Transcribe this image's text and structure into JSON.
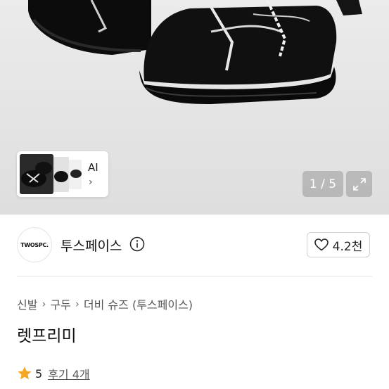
{
  "gallery": {
    "counter": "1 / 5",
    "ai_label": "AI",
    "chevron": "›",
    "expand_icon": "expand-icon"
  },
  "seller": {
    "logo_text": "TWOSPC.",
    "name": "투스페이스",
    "like_count": "4.2천"
  },
  "breadcrumb": [
    "신발",
    "구두",
    "더비 슈즈 (투스페이스)"
  ],
  "product": {
    "title": "렛프리미",
    "rating": "5",
    "review_label": "후기 4개"
  },
  "colors": {
    "star": "#f5a623",
    "text": "#222222",
    "gallery_bg": "#e4e4e4"
  }
}
